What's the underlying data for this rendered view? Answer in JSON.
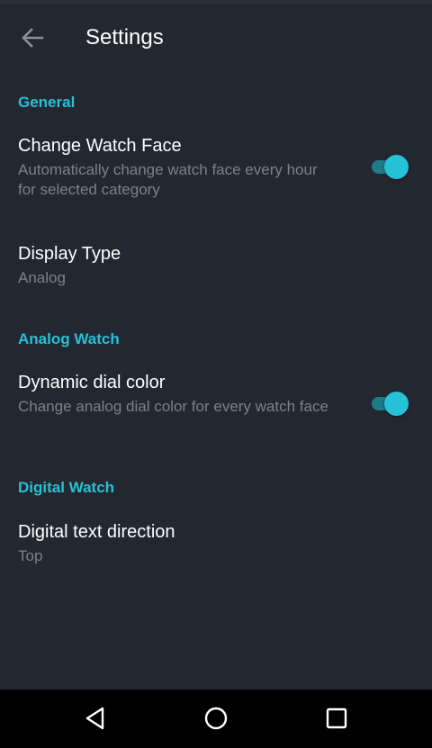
{
  "app": {
    "title": "Settings"
  },
  "colors": {
    "background": "#232730",
    "accent": "#26c1d6",
    "text_primary": "#ffffff",
    "text_secondary": "#7b818b",
    "navbar": "#000000"
  },
  "icons": {
    "back": "arrow-left-icon",
    "nav_back": "triangle-back-icon",
    "nav_home": "circle-home-icon",
    "nav_recents": "square-recents-icon"
  },
  "sections": {
    "general": {
      "header": "General",
      "change_watch_face": {
        "title": "Change Watch Face",
        "summary": "Automatically change watch face every hour for selected category",
        "enabled": true
      },
      "display_type": {
        "title": "Display Type",
        "summary": "Analog"
      }
    },
    "analog": {
      "header": "Analog Watch",
      "dynamic_dial": {
        "title": "Dynamic dial color",
        "summary": "Change analog dial color for every watch face",
        "enabled": true
      }
    },
    "digital": {
      "header": "Digital Watch",
      "text_direction": {
        "title": "Digital text direction",
        "summary": "Top"
      }
    }
  }
}
